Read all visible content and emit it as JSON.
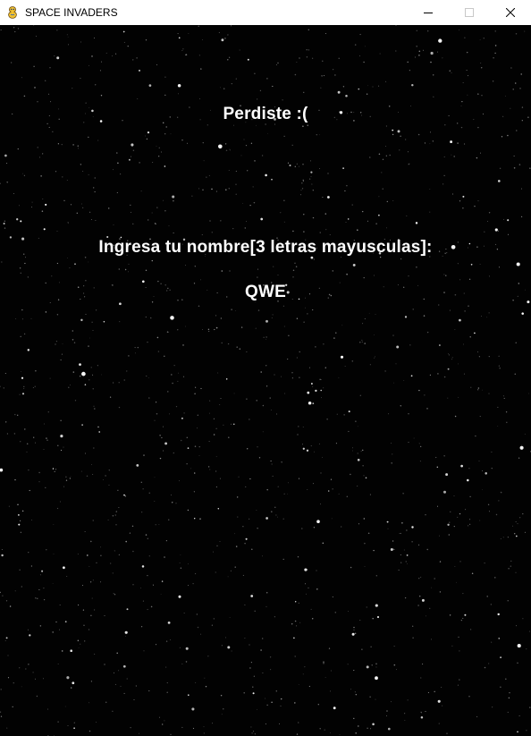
{
  "window": {
    "title": "SPACE INVADERS",
    "app_icon": "pygame-snake-icon",
    "controls": [
      "minimize-icon",
      "maximize-icon",
      "close-icon"
    ]
  },
  "game": {
    "lose_message": "Perdiste :(",
    "name_prompt": "Ingresa tu nombre[3 letras mayusculas]:",
    "name_value": "QWE",
    "background_color": "#000000",
    "text_color": "#ffffff"
  }
}
